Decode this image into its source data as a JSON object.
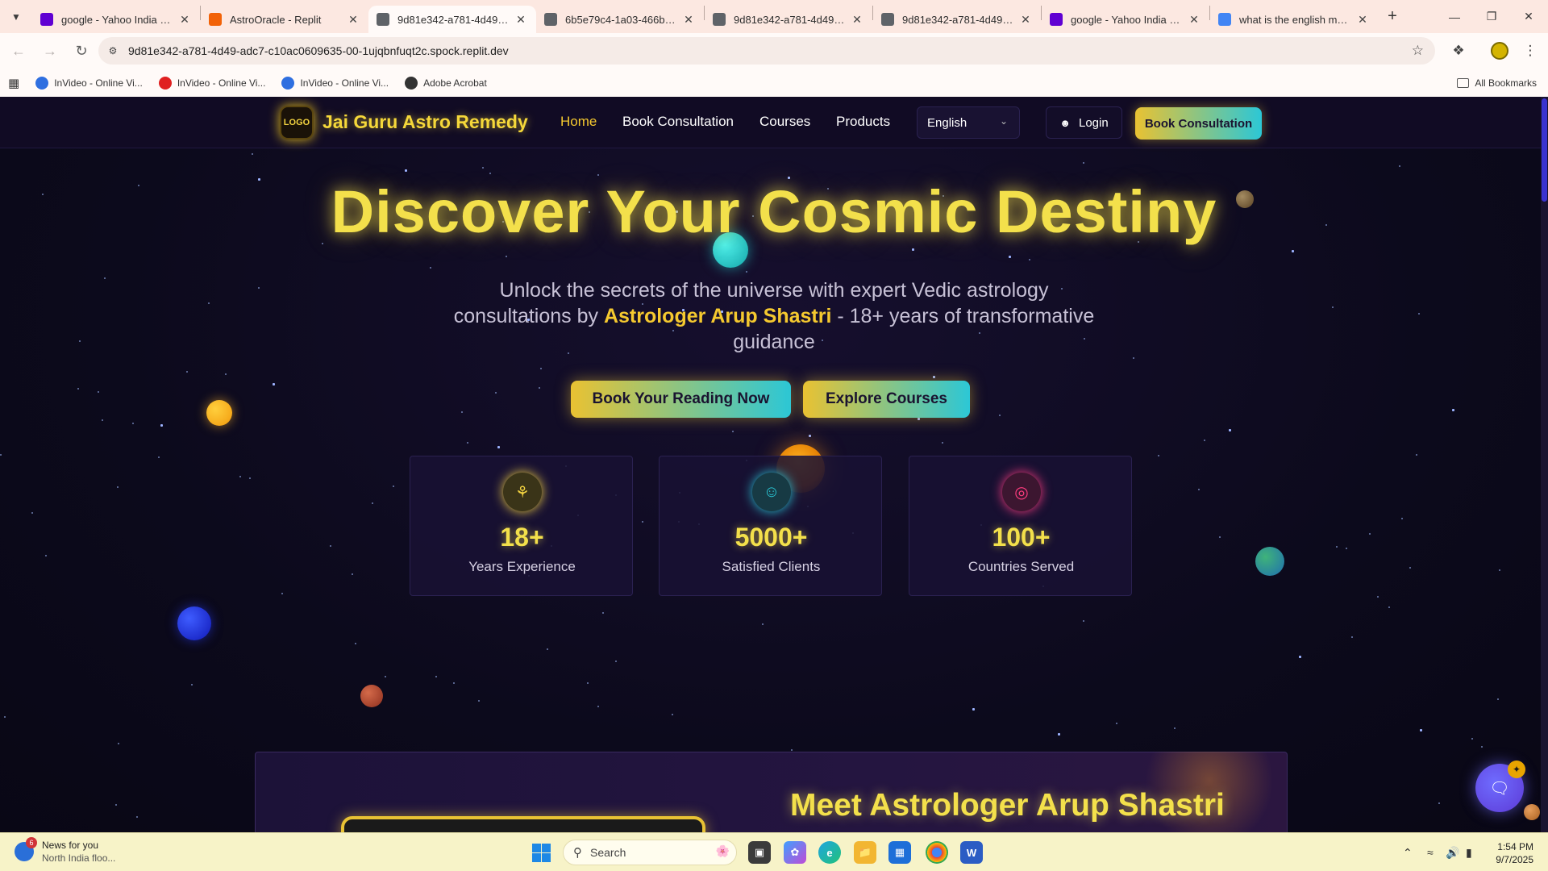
{
  "browser": {
    "tabs": [
      {
        "title": "google - Yahoo India Sear",
        "favicon": "yahoo-icon",
        "favcolor": "#6001d2",
        "active": false
      },
      {
        "title": "AstroOracle - Replit",
        "favicon": "replit-icon",
        "favcolor": "#f26207",
        "active": false
      },
      {
        "title": "9d81e342-a781-4d49-adc",
        "favicon": "globe-icon",
        "favcolor": "#5f6368",
        "active": true
      },
      {
        "title": "6b5e79c4-1a03-466b-a61",
        "favicon": "globe-icon",
        "favcolor": "#5f6368",
        "active": false
      },
      {
        "title": "9d81e342-a781-4d49-adc",
        "favicon": "globe-icon",
        "favcolor": "#5f6368",
        "active": false
      },
      {
        "title": "9d81e342-a781-4d49-adc",
        "favicon": "globe-icon",
        "favcolor": "#5f6368",
        "active": false
      },
      {
        "title": "google - Yahoo India Sear",
        "favicon": "yahoo-icon",
        "favcolor": "#6001d2",
        "active": false
      },
      {
        "title": "what is the english meani",
        "favicon": "google-icon",
        "favcolor": "#4285f4",
        "active": false
      }
    ],
    "url": "9d81e342-a781-4d49-adc7-c10ac0609635-00-1ujqbnfuqt2c.spock.replit.dev",
    "bookmarks": [
      {
        "label": "InVideo - Online Vi...",
        "color": "#2f6fe0"
      },
      {
        "label": "InVideo - Online Vi...",
        "color": "#e02020"
      },
      {
        "label": "InVideo - Online Vi...",
        "color": "#2f6fe0"
      },
      {
        "label": "Adobe Acrobat",
        "color": "#333333"
      }
    ],
    "all_bookmarks_label": "All Bookmarks"
  },
  "site": {
    "logo_text": "LOGO",
    "brand": "Jai Guru Astro Remedy",
    "nav": {
      "home": "Home",
      "book": "Book Consultation",
      "courses": "Courses",
      "products": "Products"
    },
    "language": "English",
    "login": "Login",
    "book_button": "Book Consultation",
    "hero": {
      "title": "Discover Your Cosmic Destiny",
      "sub_part1": "Unlock the secrets of the universe with expert Vedic astrology consultations by ",
      "sub_name": "Astrologer Arup Shastri",
      "sub_part2": " - 18+ years of transformative guidance",
      "cta_primary": "Book Your Reading Now",
      "cta_secondary": "Explore Courses"
    },
    "stats": [
      {
        "value": "18+",
        "label": "Years Experience",
        "icon": "award-icon",
        "color": "#f3d340",
        "bg": "#3a3418"
      },
      {
        "value": "5000+",
        "label": "Satisfied Clients",
        "icon": "users-icon",
        "color": "#2ac7d6",
        "bg": "#173a44"
      },
      {
        "value": "100+",
        "label": "Countries Served",
        "icon": "globe-icon",
        "color": "#ff3d7f",
        "bg": "#3c1630"
      }
    ],
    "meet_title": "Meet Astrologer Arup Shastri",
    "colors": {
      "accent_gold": "#f3e04b",
      "accent_cyan": "#2cc7d6",
      "background": "#0d0a1e"
    }
  },
  "taskbar": {
    "news_title": "News for you",
    "news_sub": "North India floo...",
    "news_badge": "6",
    "search_placeholder": "Search",
    "time": "1:54 PM",
    "date": "9/7/2025"
  }
}
